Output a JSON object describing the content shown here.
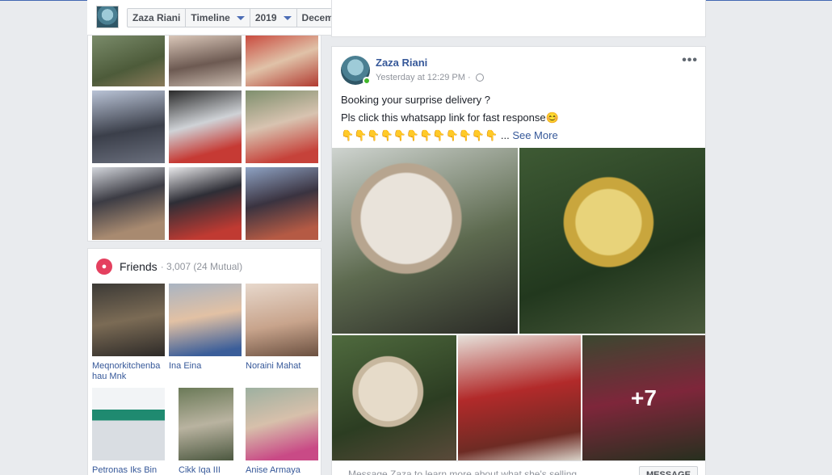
{
  "header": {
    "crumbs": [
      {
        "label": "Zaza Riani",
        "has_caret": false
      },
      {
        "label": "Timeline",
        "has_caret": true
      },
      {
        "label": "2019",
        "has_caret": true
      },
      {
        "label": "December",
        "has_caret": true
      }
    ]
  },
  "friends": {
    "heading": "Friends",
    "count": "· 3,007 (24 Mutual)",
    "icon": "friends-icon",
    "list": [
      {
        "name": "Meqnorkitchenba hau Mnk"
      },
      {
        "name": "Ina Eina"
      },
      {
        "name": "Noraini Mahat"
      },
      {
        "name": "Petronas Iks Bin"
      },
      {
        "name": "Cikk Iqa III"
      },
      {
        "name": "Anise Armaya"
      }
    ]
  },
  "post": {
    "author": "Zaza Riani",
    "time": "Yesterday at 12:29 PM ·",
    "lines": [
      "Booking your surprise delivery ?",
      "Pls click this whatsapp link for fast response😊",
      "👇👇👇👇👇👇👇👇👇👇👇👇 ..."
    ],
    "see_more": "See More",
    "more_label": "•••",
    "extra_photos": "+7",
    "message_placeholder": "Message Zaza to learn more about what she's selling",
    "message_button": "MESSAGE"
  },
  "colors": {
    "link": "#365899",
    "online": "#42b72a",
    "friends_badge": "#e4405f"
  }
}
